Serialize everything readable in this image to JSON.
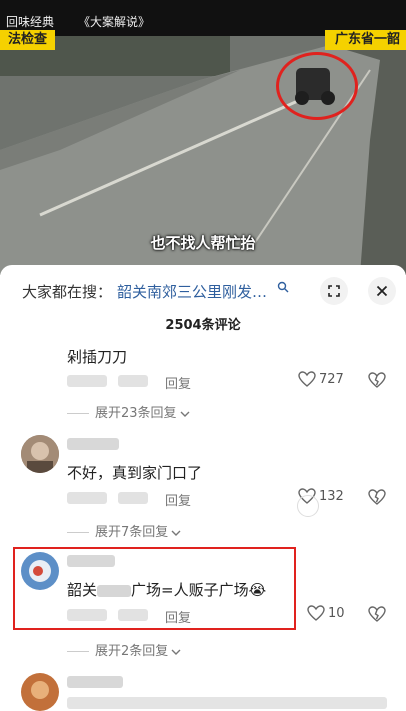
{
  "video": {
    "top_left": "回味经典",
    "top_title": "《大案解说》",
    "overlay_left": "法检查",
    "overlay_right": "广东省一韶",
    "subtitle": "也不找人帮忙抬"
  },
  "sheet": {
    "search_prefix": "大家都在搜：",
    "search_query": "韶关南郊三公里刚发…",
    "comment_count": "2504条评论",
    "expand_icon": "expand-icon",
    "close_icon": "close-icon"
  },
  "comments": [
    {
      "text": "剁插刀刀",
      "reply_label": "回复",
      "likes": "727",
      "expand_label": "展开23条回复"
    },
    {
      "text": "不好，真到家门口了",
      "reply_label": "回复",
      "likes": "132",
      "expand_label": "展开7条回复"
    },
    {
      "text_prefix": "韶关",
      "text_suffix": "广场=人贩子广场",
      "emoji": "😭",
      "reply_label": "回复",
      "likes": "10",
      "expand_label": "展开2条回复"
    }
  ],
  "colors": {
    "accent_link": "#2f5f9e",
    "highlight_red": "#e0221e",
    "overlay_yellow": "#f5d100"
  }
}
